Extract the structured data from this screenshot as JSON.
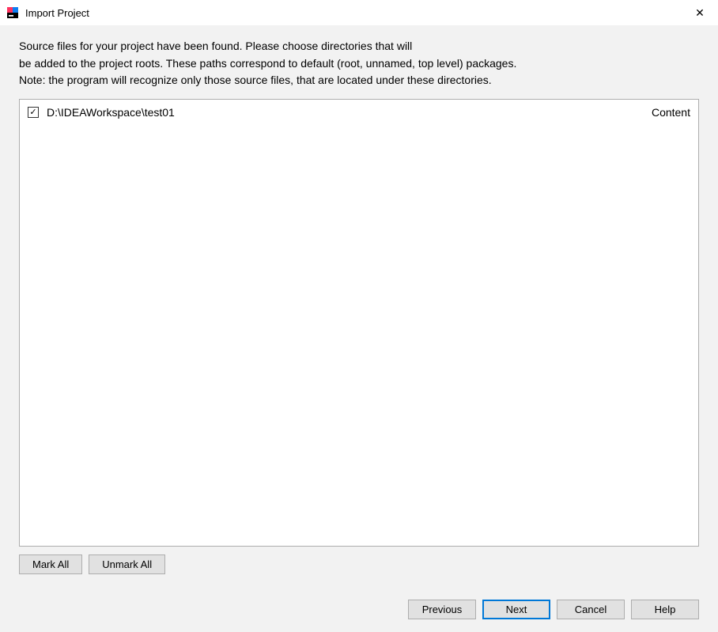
{
  "title": "Import Project",
  "description_line1": "Source files for your project have been found. Please choose directories that will",
  "description_line2": "be added to the project roots. These paths correspond to default (root, unnamed, top level) packages.",
  "description_line3": "Note: the program will recognize only those source files, that are located under these directories.",
  "directories": [
    {
      "checked": true,
      "path": "D:\\IDEAWorkspace\\test01",
      "type": "Content"
    }
  ],
  "buttons": {
    "mark_all": "Mark All",
    "unmark_all": "Unmark All",
    "previous": "Previous",
    "next": "Next",
    "cancel": "Cancel",
    "help": "Help"
  },
  "checkmark_glyph": "✓",
  "close_glyph": "✕"
}
